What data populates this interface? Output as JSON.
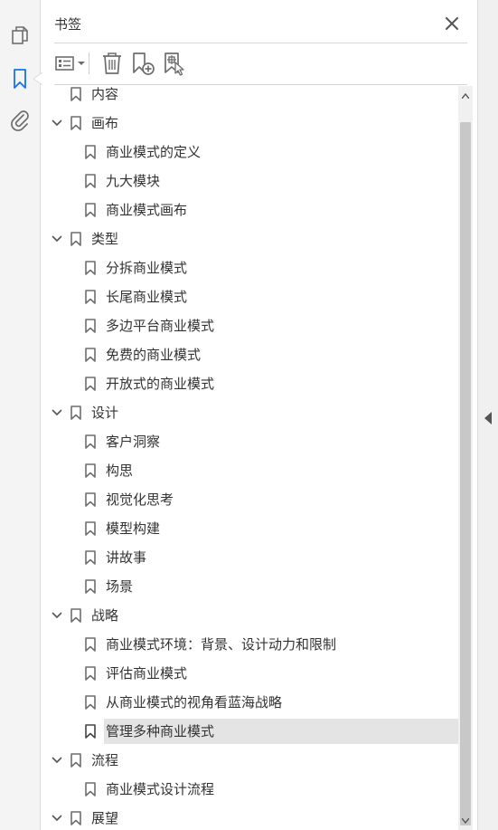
{
  "panel": {
    "title": "书签"
  },
  "left_rail": {
    "items": [
      {
        "icon": "pages-icon",
        "active": false
      },
      {
        "icon": "bookmark-icon",
        "active": true
      },
      {
        "icon": "paperclip-icon",
        "active": false
      }
    ]
  },
  "toolbar": {
    "buttons": [
      "options-menu-icon",
      "delete-icon",
      "new-bookmark-icon",
      "new-bookmark-from-structure-icon"
    ]
  },
  "colors": {
    "accent": "#1473e6",
    "icon": "#6e6e6e",
    "selected_bg": "#e4e4e4"
  },
  "tree": [
    {
      "label": "内容",
      "level": 0,
      "expandable": false
    },
    {
      "label": "画布",
      "level": 0,
      "expandable": true,
      "expanded": true
    },
    {
      "label": "商业模式的定义",
      "level": 1
    },
    {
      "label": "九大模块",
      "level": 1
    },
    {
      "label": "商业模式画布",
      "level": 1
    },
    {
      "label": "类型",
      "level": 0,
      "expandable": true,
      "expanded": true
    },
    {
      "label": "分拆商业模式",
      "level": 1
    },
    {
      "label": "长尾商业模式",
      "level": 1
    },
    {
      "label": "多边平台商业模式",
      "level": 1
    },
    {
      "label": "免费的商业模式",
      "level": 1
    },
    {
      "label": "开放式的商业模式",
      "level": 1
    },
    {
      "label": "设计",
      "level": 0,
      "expandable": true,
      "expanded": true
    },
    {
      "label": "客户洞察",
      "level": 1
    },
    {
      "label": "构思",
      "level": 1
    },
    {
      "label": "视觉化思考",
      "level": 1
    },
    {
      "label": "模型构建",
      "level": 1
    },
    {
      "label": "讲故事",
      "level": 1
    },
    {
      "label": "场景",
      "level": 1
    },
    {
      "label": "战略",
      "level": 0,
      "expandable": true,
      "expanded": true
    },
    {
      "label": "商业模式环境：背景、设计动力和限制",
      "level": 1
    },
    {
      "label": "评估商业模式",
      "level": 1
    },
    {
      "label": "从商业模式的视角看蓝海战略",
      "level": 1
    },
    {
      "label": "管理多种商业模式",
      "level": 1,
      "selected": true
    },
    {
      "label": "流程",
      "level": 0,
      "expandable": true,
      "expanded": true
    },
    {
      "label": "商业模式设计流程",
      "level": 1
    },
    {
      "label": "展望",
      "level": 0,
      "expandable": true,
      "expanded": true
    }
  ]
}
